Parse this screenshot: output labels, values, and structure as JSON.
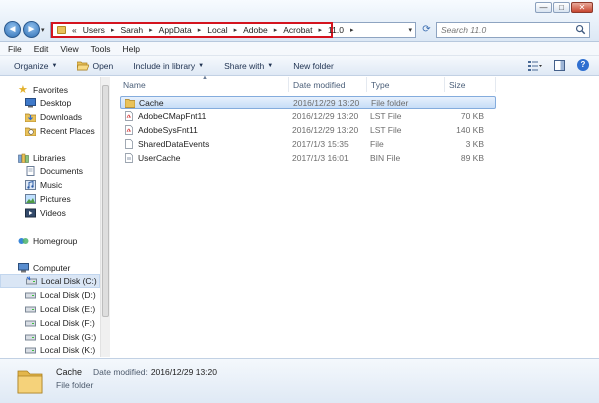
{
  "window": {
    "minimize_glyph": "—",
    "maximize_glyph": "□",
    "close_glyph": "✕"
  },
  "nav": {
    "back_glyph": "◄",
    "forward_glyph": "►",
    "history_glyph": "▾",
    "refresh_glyph": "⟳"
  },
  "address": {
    "overflow": "«",
    "crumbs": [
      "Users",
      "Sarah",
      "AppData",
      "Local",
      "Adobe",
      "Acrobat",
      "11.0"
    ],
    "separator": "▸",
    "dropdown_glyph": "▾"
  },
  "search": {
    "placeholder": "Search 11.0"
  },
  "menubar": [
    "File",
    "Edit",
    "View",
    "Tools",
    "Help"
  ],
  "toolbar": {
    "organize": "Organize",
    "open": "Open",
    "include_in_library": "Include in library",
    "share_with": "Share with",
    "new_folder": "New folder",
    "caret": "▼",
    "help_glyph": "?"
  },
  "navpane": {
    "favorites": "Favorites",
    "desktop": "Desktop",
    "downloads": "Downloads",
    "recent_places": "Recent Places",
    "libraries": "Libraries",
    "documents": "Documents",
    "music": "Music",
    "pictures": "Pictures",
    "videos": "Videos",
    "homegroup": "Homegroup",
    "computer": "Computer",
    "drives": [
      "Local Disk (C:)",
      "Local Disk (D:)",
      "Local Disk (E:)",
      "Local Disk (F:)",
      "Local Disk (G:)",
      "Local Disk (K:)"
    ]
  },
  "columns": {
    "name": "Name",
    "date": "Date modified",
    "type": "Type",
    "size": "Size",
    "sort_glyph": "▲"
  },
  "files": [
    {
      "name": "Cache",
      "date": "2016/12/29 13:20",
      "type": "File folder",
      "size": "",
      "icon": "folder-icon"
    },
    {
      "name": "AdobeCMapFnt11",
      "date": "2016/12/29 13:20",
      "type": "LST File",
      "size": "70 KB",
      "icon": "pdf-file-icon"
    },
    {
      "name": "AdobeSysFnt11",
      "date": "2016/12/29 13:20",
      "type": "LST File",
      "size": "140 KB",
      "icon": "pdf-file-icon"
    },
    {
      "name": "SharedDataEvents",
      "date": "2017/1/3 15:35",
      "type": "File",
      "size": "3 KB",
      "icon": "file-icon"
    },
    {
      "name": "UserCache",
      "date": "2017/1/3 16:01",
      "type": "BIN File",
      "size": "89 KB",
      "icon": "bin-file-icon"
    }
  ],
  "details": {
    "name": "Cache",
    "type": "File folder",
    "date_label": "Date modified:",
    "date_value": "2016/12/29 13:20"
  }
}
